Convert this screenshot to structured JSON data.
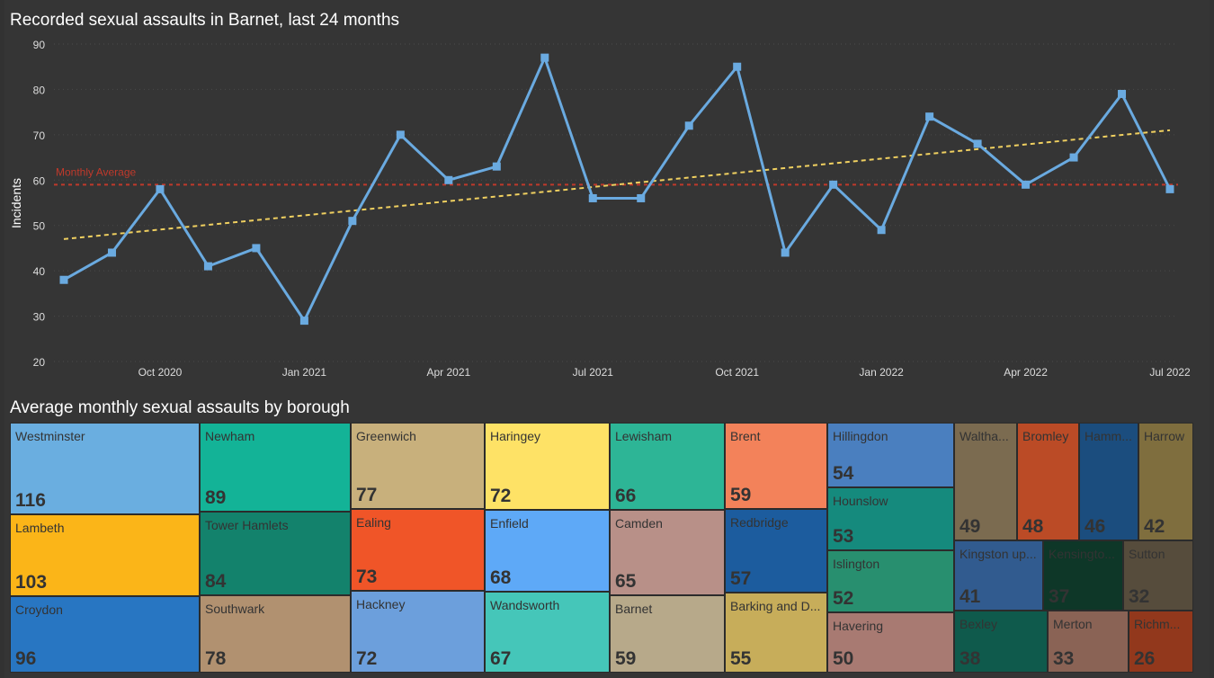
{
  "line_title": "Recorded sexual assaults in Barnet, last 24 months",
  "treemap_title": "Average monthly sexual assaults by borough",
  "colors": {
    "background": "#353535",
    "line": "#6aaae0",
    "average": "#c0392b",
    "trend": "#f0d060",
    "grid": "#4a4a4a",
    "axis_text": "#dddddd"
  },
  "chart_data": [
    {
      "type": "line",
      "title": "Recorded sexual assaults in Barnet, last 24 months",
      "ylabel": "Incidents",
      "ylim": [
        20,
        90
      ],
      "yticks": [
        20,
        30,
        40,
        50,
        60,
        70,
        80,
        90
      ],
      "x": [
        "2020-08",
        "2020-09",
        "2020-10",
        "2020-11",
        "2020-12",
        "2021-01",
        "2021-02",
        "2021-03",
        "2021-04",
        "2021-05",
        "2021-06",
        "2021-07",
        "2021-08",
        "2021-09",
        "2021-10",
        "2021-11",
        "2021-12",
        "2022-01",
        "2022-02",
        "2022-03",
        "2022-04",
        "2022-05",
        "2022-06",
        "2022-07"
      ],
      "xtick_labels": [
        "Oct 2020",
        "Jan 2021",
        "Apr 2021",
        "Jul 2021",
        "Oct 2021",
        "Jan 2022",
        "Apr 2022",
        "Jul 2022"
      ],
      "xtick_months": [
        "2020-10",
        "2021-01",
        "2021-04",
        "2021-07",
        "2021-10",
        "2022-01",
        "2022-04",
        "2022-07"
      ],
      "values": [
        38,
        44,
        58,
        41,
        45,
        29,
        51,
        70,
        60,
        63,
        87,
        56,
        56,
        72,
        85,
        44,
        59,
        49,
        74,
        68,
        59,
        65,
        79,
        58
      ],
      "average": {
        "label": "Monthly Average",
        "value": 59
      },
      "trendline": {
        "start": 47,
        "end": 71
      },
      "grid": true
    },
    {
      "type": "treemap",
      "title": "Average monthly sexual assaults by borough",
      "items": [
        {
          "name": "Westminster",
          "value": 116,
          "color": "#6aaee0",
          "text": "#333333",
          "value_text": "#333333"
        },
        {
          "name": "Lambeth",
          "value": 103,
          "color": "#fbb518",
          "text": "#333333",
          "value_text": "#333333"
        },
        {
          "name": "Croydon",
          "value": 96,
          "color": "#2876c2",
          "text": "#333333",
          "value_text": "#333333"
        },
        {
          "name": "Newham",
          "value": 89,
          "color": "#13b397",
          "text": "#333333",
          "value_text": "#333333"
        },
        {
          "name": "Tower Hamlets",
          "value": 84,
          "color": "#13826c",
          "text": "#333333",
          "value_text": "#333333"
        },
        {
          "name": "Southwark",
          "value": 78,
          "color": "#b19170",
          "text": "#333333",
          "value_text": "#333333"
        },
        {
          "name": "Greenwich",
          "value": 77,
          "color": "#c8b07c",
          "text": "#333333",
          "value_text": "#333333"
        },
        {
          "name": "Ealing",
          "value": 73,
          "color": "#f05528",
          "text": "#333333",
          "value_text": "#333333"
        },
        {
          "name": "Hackney",
          "value": 72,
          "color": "#6c9fdc",
          "text": "#333333",
          "value_text": "#333333"
        },
        {
          "name": "Haringey",
          "value": 72,
          "color": "#fee266",
          "text": "#333333",
          "value_text": "#333333"
        },
        {
          "name": "Enfield",
          "value": 68,
          "color": "#5ea9f7",
          "text": "#333333",
          "value_text": "#333333"
        },
        {
          "name": "Wandsworth",
          "value": 67,
          "color": "#45c6b9",
          "text": "#333333",
          "value_text": "#333333"
        },
        {
          "name": "Lewisham",
          "value": 66,
          "color": "#2db596",
          "text": "#333333",
          "value_text": "#333333"
        },
        {
          "name": "Camden",
          "value": 65,
          "color": "#b89088",
          "text": "#333333",
          "value_text": "#333333"
        },
        {
          "name": "Barnet",
          "value": 59,
          "color": "#b7a98a",
          "text": "#333333",
          "value_text": "#333333"
        },
        {
          "name": "Brent",
          "value": 59,
          "color": "#f3825a",
          "text": "#333333",
          "value_text": "#333333"
        },
        {
          "name": "Redbridge",
          "value": 57,
          "color": "#1c5c9e",
          "text": "#333333",
          "value_text": "#333333"
        },
        {
          "name": "Barking and D...",
          "value": 55,
          "color": "#c7ad5a",
          "text": "#333333",
          "value_text": "#333333"
        },
        {
          "name": "Hillingdon",
          "value": 54,
          "color": "#4a7fbf",
          "text": "#333333",
          "value_text": "#333333"
        },
        {
          "name": "Hounslow",
          "value": 53,
          "color": "#158a7d",
          "text": "#333333",
          "value_text": "#333333"
        },
        {
          "name": "Islington",
          "value": 52,
          "color": "#288f6f",
          "text": "#333333",
          "value_text": "#333333"
        },
        {
          "name": "Havering",
          "value": 50,
          "color": "#a87a72",
          "text": "#333333",
          "value_text": "#333333"
        },
        {
          "name": "Waltha...",
          "value": 49,
          "color": "#7b6b50",
          "text": "#333333",
          "value_text": "#333333"
        },
        {
          "name": "Bromley",
          "value": 48,
          "color": "#bb4b26",
          "text": "#333333",
          "value_text": "#333333"
        },
        {
          "name": "Hamm...",
          "value": 46,
          "color": "#1b4d7e",
          "text": "#333333",
          "value_text": "#333333"
        },
        {
          "name": "Harrow",
          "value": 42,
          "color": "#7f6e3e",
          "text": "#333333",
          "value_text": "#333333"
        },
        {
          "name": "Kingston up...",
          "value": 41,
          "color": "#315b8f",
          "text": "#333333",
          "value_text": "#333333"
        },
        {
          "name": "Kensingto...",
          "value": 37,
          "color": "#0e3728",
          "text": "#333333",
          "value_text": "#333333"
        },
        {
          "name": "Sutton",
          "value": 32,
          "color": "#564c3c",
          "text": "#333333",
          "value_text": "#333333"
        },
        {
          "name": "Bexley",
          "value": 38,
          "color": "#0f5a4c",
          "text": "#333333",
          "value_text": "#333333"
        },
        {
          "name": "Merton",
          "value": 33,
          "color": "#8a6355",
          "text": "#333333",
          "value_text": "#333333"
        },
        {
          "name": "Richm...",
          "value": 26,
          "color": "#92381c",
          "text": "#333333",
          "value_text": "#333333"
        }
      ]
    }
  ]
}
